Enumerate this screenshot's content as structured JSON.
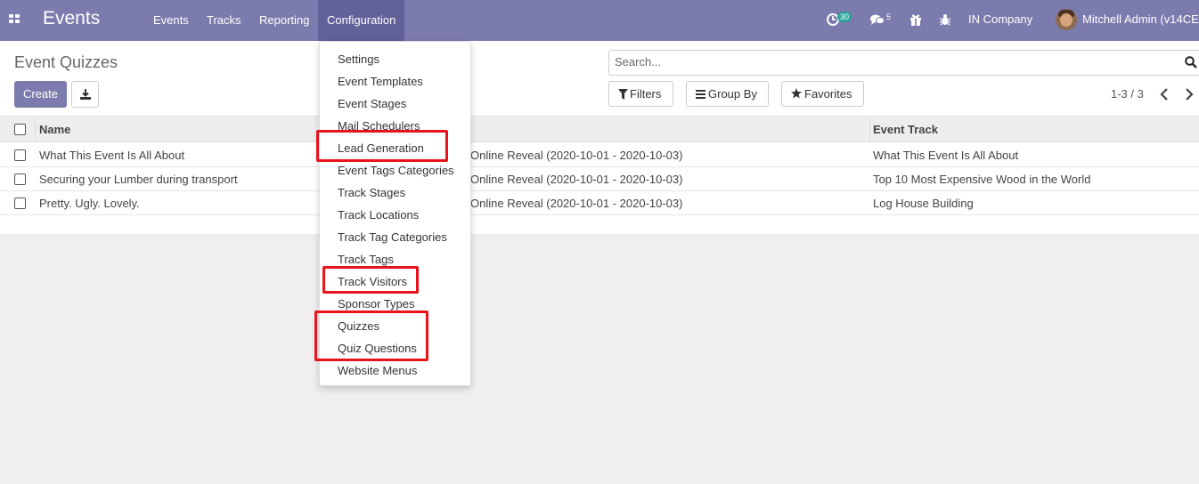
{
  "colors": {
    "navbar": "#7c7bad",
    "navbar_active": "#62619a",
    "primary_button": "#7c7bad",
    "highlight_box": "#e8131c",
    "activity_badge": "#2da59d"
  },
  "navbar": {
    "app_title": "Events",
    "menu": [
      {
        "label": "Events"
      },
      {
        "label": "Tracks"
      },
      {
        "label": "Reporting"
      },
      {
        "label": "Configuration"
      }
    ],
    "activity_count": "30",
    "messages_count": "5",
    "company": "IN Company",
    "user": "Mitchell Admin (v14CE"
  },
  "control_panel": {
    "title": "Event Quizzes",
    "create_label": "Create",
    "search_placeholder": "Search...",
    "filters_label": "Filters",
    "groupby_label": "Group By",
    "favorites_label": "Favorites",
    "pager": "1-3 / 3"
  },
  "table": {
    "columns": [
      {
        "label": "Name"
      },
      {
        "label": ""
      },
      {
        "label": "Event Track"
      }
    ],
    "rows": [
      {
        "name": "What This Event Is All About",
        "event": "Online Reveal (2020-10-01 - 2020-10-03)",
        "track": "What This Event Is All About"
      },
      {
        "name": "Securing your Lumber during transport",
        "event": "Online Reveal (2020-10-01 - 2020-10-03)",
        "track": "Top 10 Most Expensive Wood in the World"
      },
      {
        "name": "Pretty. Ugly. Lovely.",
        "event": "Online Reveal (2020-10-01 - 2020-10-03)",
        "track": "Log House Building"
      }
    ]
  },
  "config_menu": [
    {
      "label": "Settings"
    },
    {
      "label": "Event Templates"
    },
    {
      "label": "Event Stages"
    },
    {
      "label": "Mail Schedulers"
    },
    {
      "label": "Lead Generation"
    },
    {
      "label": "Event Tags Categories"
    },
    {
      "label": "Track Stages"
    },
    {
      "label": "Track Locations"
    },
    {
      "label": "Track Tag Categories"
    },
    {
      "label": "Track Tags"
    },
    {
      "label": "Track Visitors"
    },
    {
      "label": "Sponsor Types"
    },
    {
      "label": "Quizzes"
    },
    {
      "label": "Quiz Questions"
    },
    {
      "label": "Website Menus"
    }
  ],
  "icons": [
    "apps-grid-icon",
    "activity-clock-icon",
    "chat-icon",
    "gift-icon",
    "bug-icon",
    "download-icon",
    "search-icon",
    "filter-icon",
    "group-by-icon",
    "star-icon",
    "chevron-left-icon",
    "chevron-right-icon",
    "checkbox-icon"
  ]
}
